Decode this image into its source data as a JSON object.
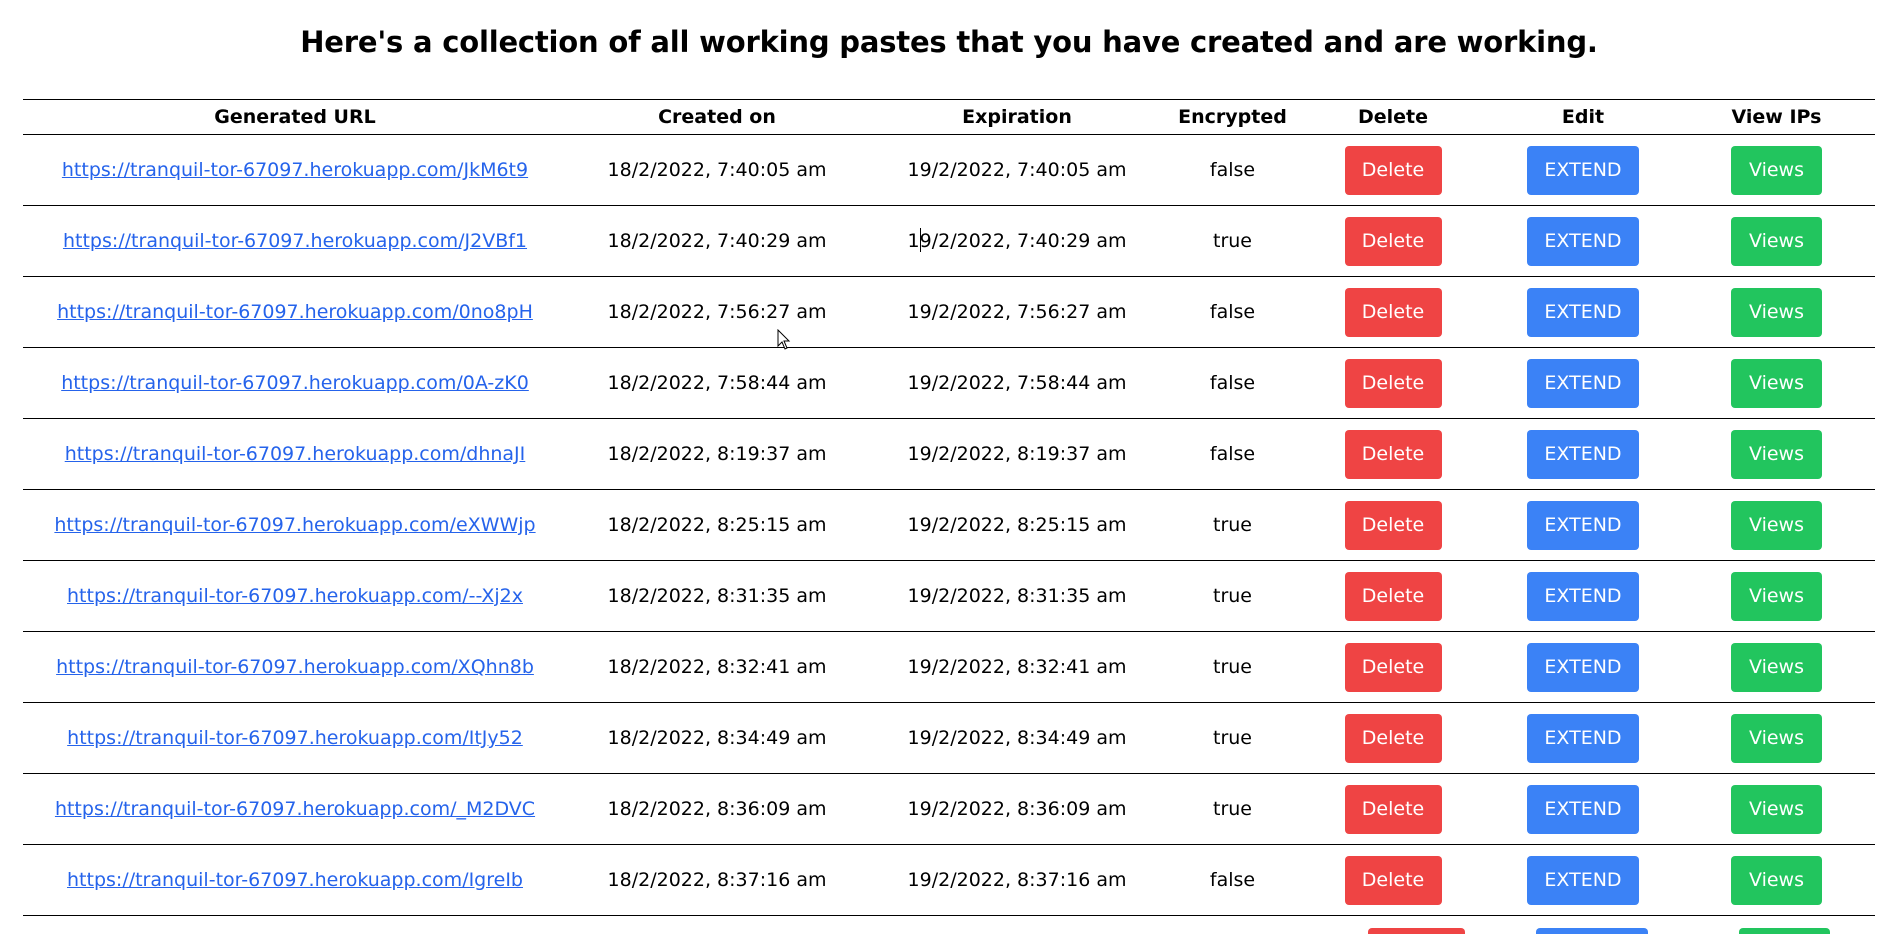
{
  "page": {
    "title": "Here's a collection of all working pastes that you have created and are working."
  },
  "table": {
    "headers": {
      "url": "Generated URL",
      "created": "Created on",
      "expiration": "Expiration",
      "encrypted": "Encrypted",
      "delete": "Delete",
      "edit": "Edit",
      "view_ips": "View IPs"
    },
    "rows": [
      {
        "url": "https://tranquil-tor-67097.herokuapp.com/JkM6t9",
        "created": "18/2/2022, 7:40:05 am",
        "expiration": "19/2/2022, 7:40:05 am",
        "encrypted": "false",
        "delete_label": "Delete",
        "extend_label": "EXTEND",
        "views_label": "Views"
      },
      {
        "url": "https://tranquil-tor-67097.herokuapp.com/J2VBf1",
        "created": "18/2/2022, 7:40:29 am",
        "expiration": "19/2/2022, 7:40:29 am",
        "encrypted": "true",
        "delete_label": "Delete",
        "extend_label": "EXTEND",
        "views_label": "Views"
      },
      {
        "url": "https://tranquil-tor-67097.herokuapp.com/0no8pH",
        "created": "18/2/2022, 7:56:27 am",
        "expiration": "19/2/2022, 7:56:27 am",
        "encrypted": "false",
        "delete_label": "Delete",
        "extend_label": "EXTEND",
        "views_label": "Views"
      },
      {
        "url": "https://tranquil-tor-67097.herokuapp.com/0A-zK0",
        "created": "18/2/2022, 7:58:44 am",
        "expiration": "19/2/2022, 7:58:44 am",
        "encrypted": "false",
        "delete_label": "Delete",
        "extend_label": "EXTEND",
        "views_label": "Views"
      },
      {
        "url": "https://tranquil-tor-67097.herokuapp.com/dhnaJI",
        "created": "18/2/2022, 8:19:37 am",
        "expiration": "19/2/2022, 8:19:37 am",
        "encrypted": "false",
        "delete_label": "Delete",
        "extend_label": "EXTEND",
        "views_label": "Views"
      },
      {
        "url": "https://tranquil-tor-67097.herokuapp.com/eXWWjp",
        "created": "18/2/2022, 8:25:15 am",
        "expiration": "19/2/2022, 8:25:15 am",
        "encrypted": "true",
        "delete_label": "Delete",
        "extend_label": "EXTEND",
        "views_label": "Views"
      },
      {
        "url": "https://tranquil-tor-67097.herokuapp.com/--Xj2x",
        "created": "18/2/2022, 8:31:35 am",
        "expiration": "19/2/2022, 8:31:35 am",
        "encrypted": "true",
        "delete_label": "Delete",
        "extend_label": "EXTEND",
        "views_label": "Views"
      },
      {
        "url": "https://tranquil-tor-67097.herokuapp.com/XQhn8b",
        "created": "18/2/2022, 8:32:41 am",
        "expiration": "19/2/2022, 8:32:41 am",
        "encrypted": "true",
        "delete_label": "Delete",
        "extend_label": "EXTEND",
        "views_label": "Views"
      },
      {
        "url": "https://tranquil-tor-67097.herokuapp.com/ItJy52",
        "created": "18/2/2022, 8:34:49 am",
        "expiration": "19/2/2022, 8:34:49 am",
        "encrypted": "true",
        "delete_label": "Delete",
        "extend_label": "EXTEND",
        "views_label": "Views"
      },
      {
        "url": "https://tranquil-tor-67097.herokuapp.com/_M2DVC",
        "created": "18/2/2022, 8:36:09 am",
        "expiration": "19/2/2022, 8:36:09 am",
        "encrypted": "true",
        "delete_label": "Delete",
        "extend_label": "EXTEND",
        "views_label": "Views"
      },
      {
        "url": "https://tranquil-tor-67097.herokuapp.com/IgreIb",
        "created": "18/2/2022, 8:37:16 am",
        "expiration": "19/2/2022, 8:37:16 am",
        "encrypted": "false",
        "delete_label": "Delete",
        "extend_label": "EXTEND",
        "views_label": "Views"
      }
    ]
  },
  "colors": {
    "delete": "#ef4444",
    "extend": "#3b82f6",
    "views": "#22c55e",
    "link": "#2563eb"
  },
  "icons": {
    "cursor": "mouse-pointer-icon"
  }
}
